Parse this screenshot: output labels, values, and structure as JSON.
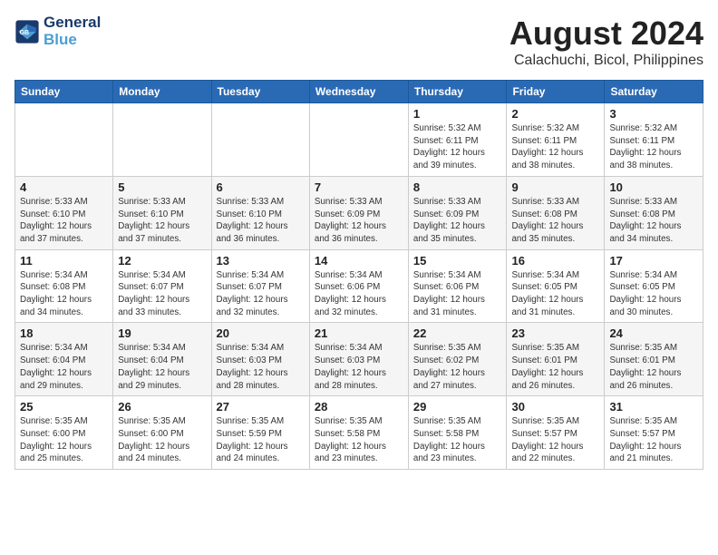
{
  "header": {
    "logo_line1": "General",
    "logo_line2": "Blue",
    "month_year": "August 2024",
    "location": "Calachuchi, Bicol, Philippines"
  },
  "days_of_week": [
    "Sunday",
    "Monday",
    "Tuesday",
    "Wednesday",
    "Thursday",
    "Friday",
    "Saturday"
  ],
  "weeks": [
    [
      {
        "num": "",
        "info": ""
      },
      {
        "num": "",
        "info": ""
      },
      {
        "num": "",
        "info": ""
      },
      {
        "num": "",
        "info": ""
      },
      {
        "num": "1",
        "info": "Sunrise: 5:32 AM\nSunset: 6:11 PM\nDaylight: 12 hours\nand 39 minutes."
      },
      {
        "num": "2",
        "info": "Sunrise: 5:32 AM\nSunset: 6:11 PM\nDaylight: 12 hours\nand 38 minutes."
      },
      {
        "num": "3",
        "info": "Sunrise: 5:32 AM\nSunset: 6:11 PM\nDaylight: 12 hours\nand 38 minutes."
      }
    ],
    [
      {
        "num": "4",
        "info": "Sunrise: 5:33 AM\nSunset: 6:10 PM\nDaylight: 12 hours\nand 37 minutes."
      },
      {
        "num": "5",
        "info": "Sunrise: 5:33 AM\nSunset: 6:10 PM\nDaylight: 12 hours\nand 37 minutes."
      },
      {
        "num": "6",
        "info": "Sunrise: 5:33 AM\nSunset: 6:10 PM\nDaylight: 12 hours\nand 36 minutes."
      },
      {
        "num": "7",
        "info": "Sunrise: 5:33 AM\nSunset: 6:09 PM\nDaylight: 12 hours\nand 36 minutes."
      },
      {
        "num": "8",
        "info": "Sunrise: 5:33 AM\nSunset: 6:09 PM\nDaylight: 12 hours\nand 35 minutes."
      },
      {
        "num": "9",
        "info": "Sunrise: 5:33 AM\nSunset: 6:08 PM\nDaylight: 12 hours\nand 35 minutes."
      },
      {
        "num": "10",
        "info": "Sunrise: 5:33 AM\nSunset: 6:08 PM\nDaylight: 12 hours\nand 34 minutes."
      }
    ],
    [
      {
        "num": "11",
        "info": "Sunrise: 5:34 AM\nSunset: 6:08 PM\nDaylight: 12 hours\nand 34 minutes."
      },
      {
        "num": "12",
        "info": "Sunrise: 5:34 AM\nSunset: 6:07 PM\nDaylight: 12 hours\nand 33 minutes."
      },
      {
        "num": "13",
        "info": "Sunrise: 5:34 AM\nSunset: 6:07 PM\nDaylight: 12 hours\nand 32 minutes."
      },
      {
        "num": "14",
        "info": "Sunrise: 5:34 AM\nSunset: 6:06 PM\nDaylight: 12 hours\nand 32 minutes."
      },
      {
        "num": "15",
        "info": "Sunrise: 5:34 AM\nSunset: 6:06 PM\nDaylight: 12 hours\nand 31 minutes."
      },
      {
        "num": "16",
        "info": "Sunrise: 5:34 AM\nSunset: 6:05 PM\nDaylight: 12 hours\nand 31 minutes."
      },
      {
        "num": "17",
        "info": "Sunrise: 5:34 AM\nSunset: 6:05 PM\nDaylight: 12 hours\nand 30 minutes."
      }
    ],
    [
      {
        "num": "18",
        "info": "Sunrise: 5:34 AM\nSunset: 6:04 PM\nDaylight: 12 hours\nand 29 minutes."
      },
      {
        "num": "19",
        "info": "Sunrise: 5:34 AM\nSunset: 6:04 PM\nDaylight: 12 hours\nand 29 minutes."
      },
      {
        "num": "20",
        "info": "Sunrise: 5:34 AM\nSunset: 6:03 PM\nDaylight: 12 hours\nand 28 minutes."
      },
      {
        "num": "21",
        "info": "Sunrise: 5:34 AM\nSunset: 6:03 PM\nDaylight: 12 hours\nand 28 minutes."
      },
      {
        "num": "22",
        "info": "Sunrise: 5:35 AM\nSunset: 6:02 PM\nDaylight: 12 hours\nand 27 minutes."
      },
      {
        "num": "23",
        "info": "Sunrise: 5:35 AM\nSunset: 6:01 PM\nDaylight: 12 hours\nand 26 minutes."
      },
      {
        "num": "24",
        "info": "Sunrise: 5:35 AM\nSunset: 6:01 PM\nDaylight: 12 hours\nand 26 minutes."
      }
    ],
    [
      {
        "num": "25",
        "info": "Sunrise: 5:35 AM\nSunset: 6:00 PM\nDaylight: 12 hours\nand 25 minutes."
      },
      {
        "num": "26",
        "info": "Sunrise: 5:35 AM\nSunset: 6:00 PM\nDaylight: 12 hours\nand 24 minutes."
      },
      {
        "num": "27",
        "info": "Sunrise: 5:35 AM\nSunset: 5:59 PM\nDaylight: 12 hours\nand 24 minutes."
      },
      {
        "num": "28",
        "info": "Sunrise: 5:35 AM\nSunset: 5:58 PM\nDaylight: 12 hours\nand 23 minutes."
      },
      {
        "num": "29",
        "info": "Sunrise: 5:35 AM\nSunset: 5:58 PM\nDaylight: 12 hours\nand 23 minutes."
      },
      {
        "num": "30",
        "info": "Sunrise: 5:35 AM\nSunset: 5:57 PM\nDaylight: 12 hours\nand 22 minutes."
      },
      {
        "num": "31",
        "info": "Sunrise: 5:35 AM\nSunset: 5:57 PM\nDaylight: 12 hours\nand 21 minutes."
      }
    ]
  ]
}
